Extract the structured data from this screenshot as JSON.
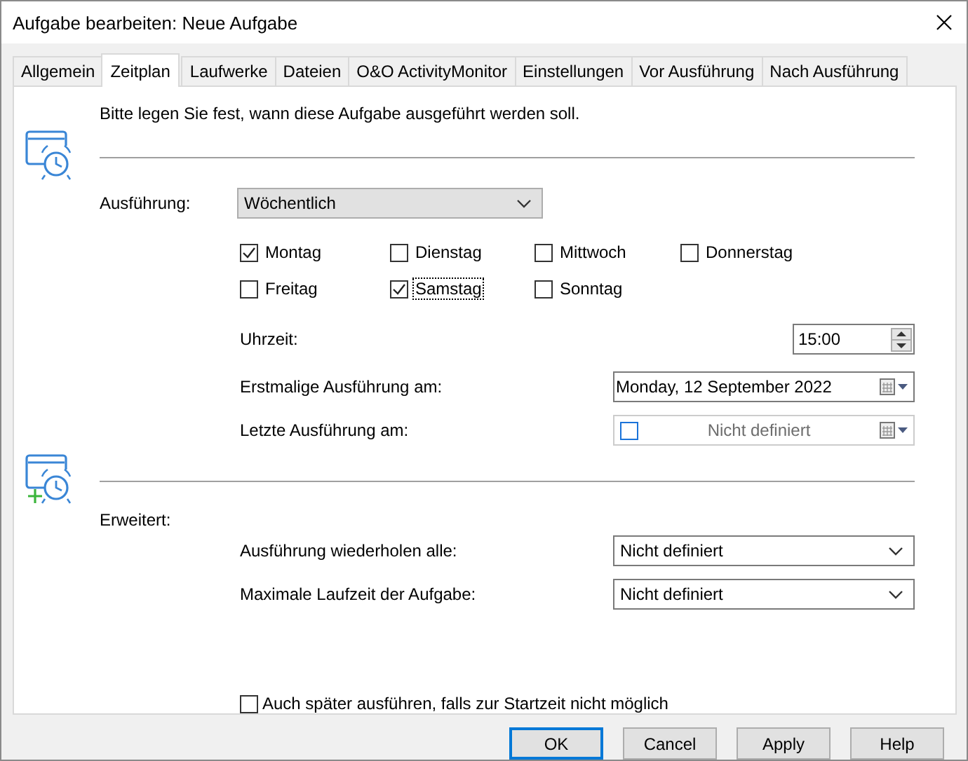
{
  "window": {
    "title": "Aufgabe bearbeiten: Neue Aufgabe"
  },
  "tabs": [
    {
      "label": "Allgemein",
      "selected": false
    },
    {
      "label": "Zeitplan",
      "selected": true
    },
    {
      "label": "Laufwerke",
      "selected": false
    },
    {
      "label": "Dateien",
      "selected": false
    },
    {
      "label": "O&O ActivityMonitor",
      "selected": false
    },
    {
      "label": "Einstellungen",
      "selected": false
    },
    {
      "label": "Vor Ausführung",
      "selected": false
    },
    {
      "label": "Nach Ausführung",
      "selected": false
    }
  ],
  "intro": "Bitte legen Sie fest, wann diese Aufgabe ausgeführt werden soll.",
  "execution": {
    "label": "Ausführung:",
    "value": "Wöchentlich"
  },
  "days": [
    {
      "label": "Montag",
      "checked": true,
      "focused": false
    },
    {
      "label": "Dienstag",
      "checked": false,
      "focused": false
    },
    {
      "label": "Mittwoch",
      "checked": false,
      "focused": false
    },
    {
      "label": "Donnerstag",
      "checked": false,
      "focused": false
    },
    {
      "label": "Freitag",
      "checked": false,
      "focused": false
    },
    {
      "label": "Samstag",
      "checked": true,
      "focused": true
    },
    {
      "label": "Sonntag",
      "checked": false,
      "focused": false
    }
  ],
  "time": {
    "label": "Uhrzeit:",
    "value": "15:00"
  },
  "first_run": {
    "label": "Erstmalige Ausführung am:",
    "value": "Monday, 12 September 2022"
  },
  "last_run": {
    "label": "Letzte Ausführung am:",
    "checked": false,
    "disabled": true,
    "value": "Nicht definiert"
  },
  "advanced": {
    "label": "Erweitert:",
    "fields": [
      {
        "label": "Ausführung wiederholen alle:",
        "value": "Nicht definiert"
      },
      {
        "label": "Maximale Laufzeit der Aufgabe:",
        "value": "Nicht definiert"
      }
    ]
  },
  "run_later": {
    "label": "Auch später ausführen, falls zur Startzeit nicht möglich",
    "checked": false
  },
  "buttons": [
    {
      "label": "OK",
      "default": true
    },
    {
      "label": "Cancel",
      "default": false
    },
    {
      "label": "Apply",
      "default": false
    },
    {
      "label": "Help",
      "default": false
    }
  ]
}
